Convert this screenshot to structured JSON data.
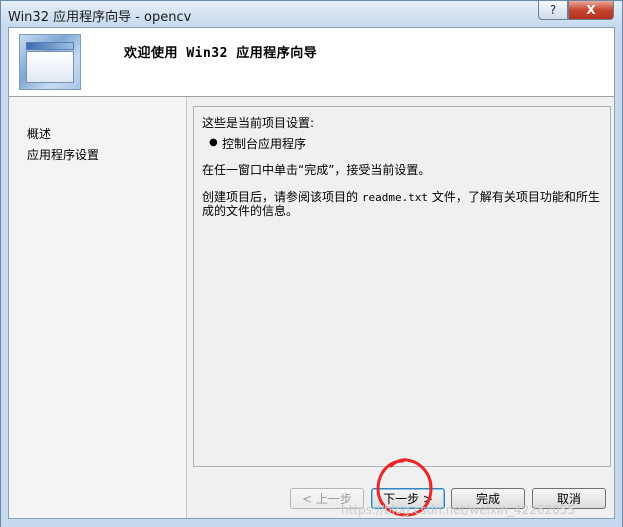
{
  "window": {
    "title": "Win32 应用程序向导 - opencv",
    "help_label": "?",
    "close_label": "X"
  },
  "header": {
    "title": "欢迎使用 Win32 应用程序向导"
  },
  "sidebar": {
    "items": [
      {
        "label": "概述"
      },
      {
        "label": "应用程序设置"
      }
    ]
  },
  "content": {
    "intro": "这些是当前项目设置:",
    "settings": [
      "控制台应用程序"
    ],
    "instruction": "在任一窗口中单击“完成”，接受当前设置。",
    "note_prefix": "创建项目后，请参阅该项目的 ",
    "note_file": "readme.txt",
    "note_suffix": " 文件，了解有关项目功能和所生",
    "note_line2": "成的文件的信息。"
  },
  "buttons": {
    "prev": "< 上一步",
    "next": "下一步 >",
    "finish": "完成",
    "cancel": "取消"
  },
  "colors": {
    "annotation": "#e8262a",
    "focus_border": "#3c7fb1"
  },
  "watermark": "https://blog.csdn.net/weixin_42262055"
}
